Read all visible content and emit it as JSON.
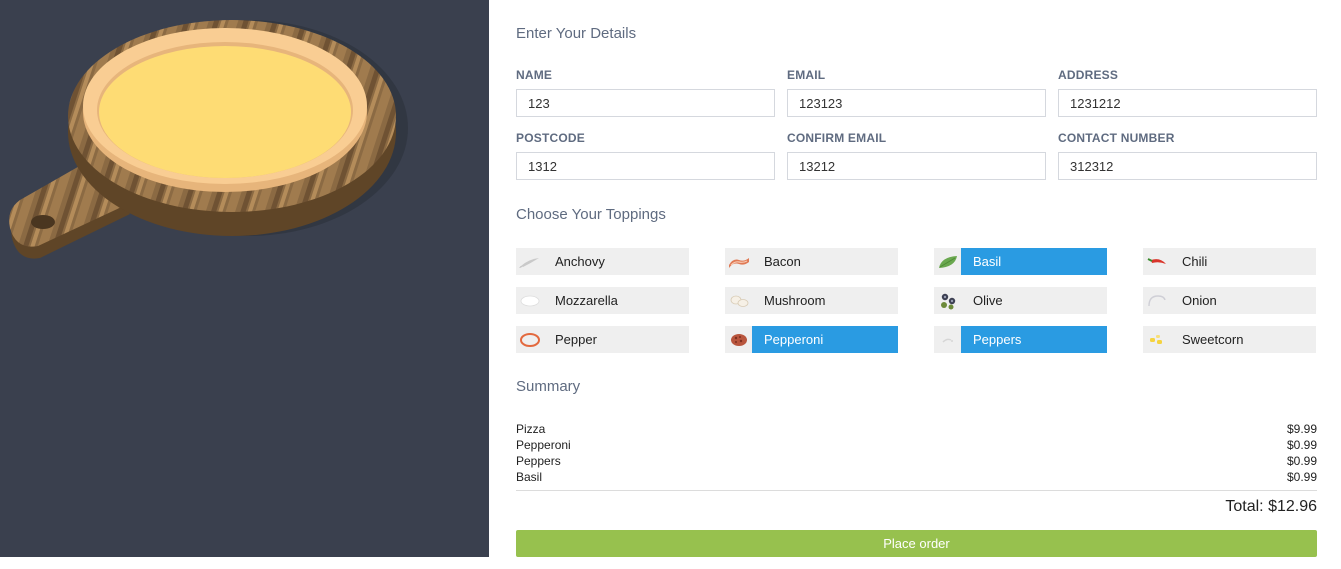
{
  "details": {
    "title": "Enter Your Details",
    "fields": [
      {
        "label": "NAME",
        "value": "123"
      },
      {
        "label": "EMAIL",
        "value": "123123"
      },
      {
        "label": "ADDRESS",
        "value": "1231212"
      },
      {
        "label": "POSTCODE",
        "value": "1312"
      },
      {
        "label": "CONFIRM EMAIL",
        "value": "13212"
      },
      {
        "label": "CONTACT NUMBER",
        "value": "312312"
      }
    ]
  },
  "toppings": {
    "title": "Choose Your Toppings",
    "items": [
      {
        "label": "Anchovy",
        "icon": "anchovy-icon",
        "selected": false
      },
      {
        "label": "Bacon",
        "icon": "bacon-icon",
        "selected": false
      },
      {
        "label": "Basil",
        "icon": "basil-icon",
        "selected": true
      },
      {
        "label": "Chili",
        "icon": "chili-icon",
        "selected": false
      },
      {
        "label": "Mozzarella",
        "icon": "mozzarella-icon",
        "selected": false
      },
      {
        "label": "Mushroom",
        "icon": "mushroom-icon",
        "selected": false
      },
      {
        "label": "Olive",
        "icon": "olive-icon",
        "selected": false
      },
      {
        "label": "Onion",
        "icon": "onion-icon",
        "selected": false
      },
      {
        "label": "Pepper",
        "icon": "pepper-icon",
        "selected": false
      },
      {
        "label": "Pepperoni",
        "icon": "pepperoni-icon",
        "selected": true
      },
      {
        "label": "Peppers",
        "icon": "peppers-icon",
        "selected": true
      },
      {
        "label": "Sweetcorn",
        "icon": "sweetcorn-icon",
        "selected": false
      }
    ]
  },
  "summary": {
    "title": "Summary",
    "rows": [
      {
        "name": "Pizza",
        "price": "$9.99"
      },
      {
        "name": "Pepperoni",
        "price": "$0.99"
      },
      {
        "name": "Peppers",
        "price": "$0.99"
      },
      {
        "name": "Basil",
        "price": "$0.99"
      }
    ],
    "total": "Total: $12.96",
    "button_label": "Place order"
  },
  "colors": {
    "left_panel_bg": "#3a404e",
    "selected_topping": "#2a9be2",
    "order_button": "#97c14e",
    "cheese": "#fedc74",
    "crust": "#f9cd93"
  }
}
